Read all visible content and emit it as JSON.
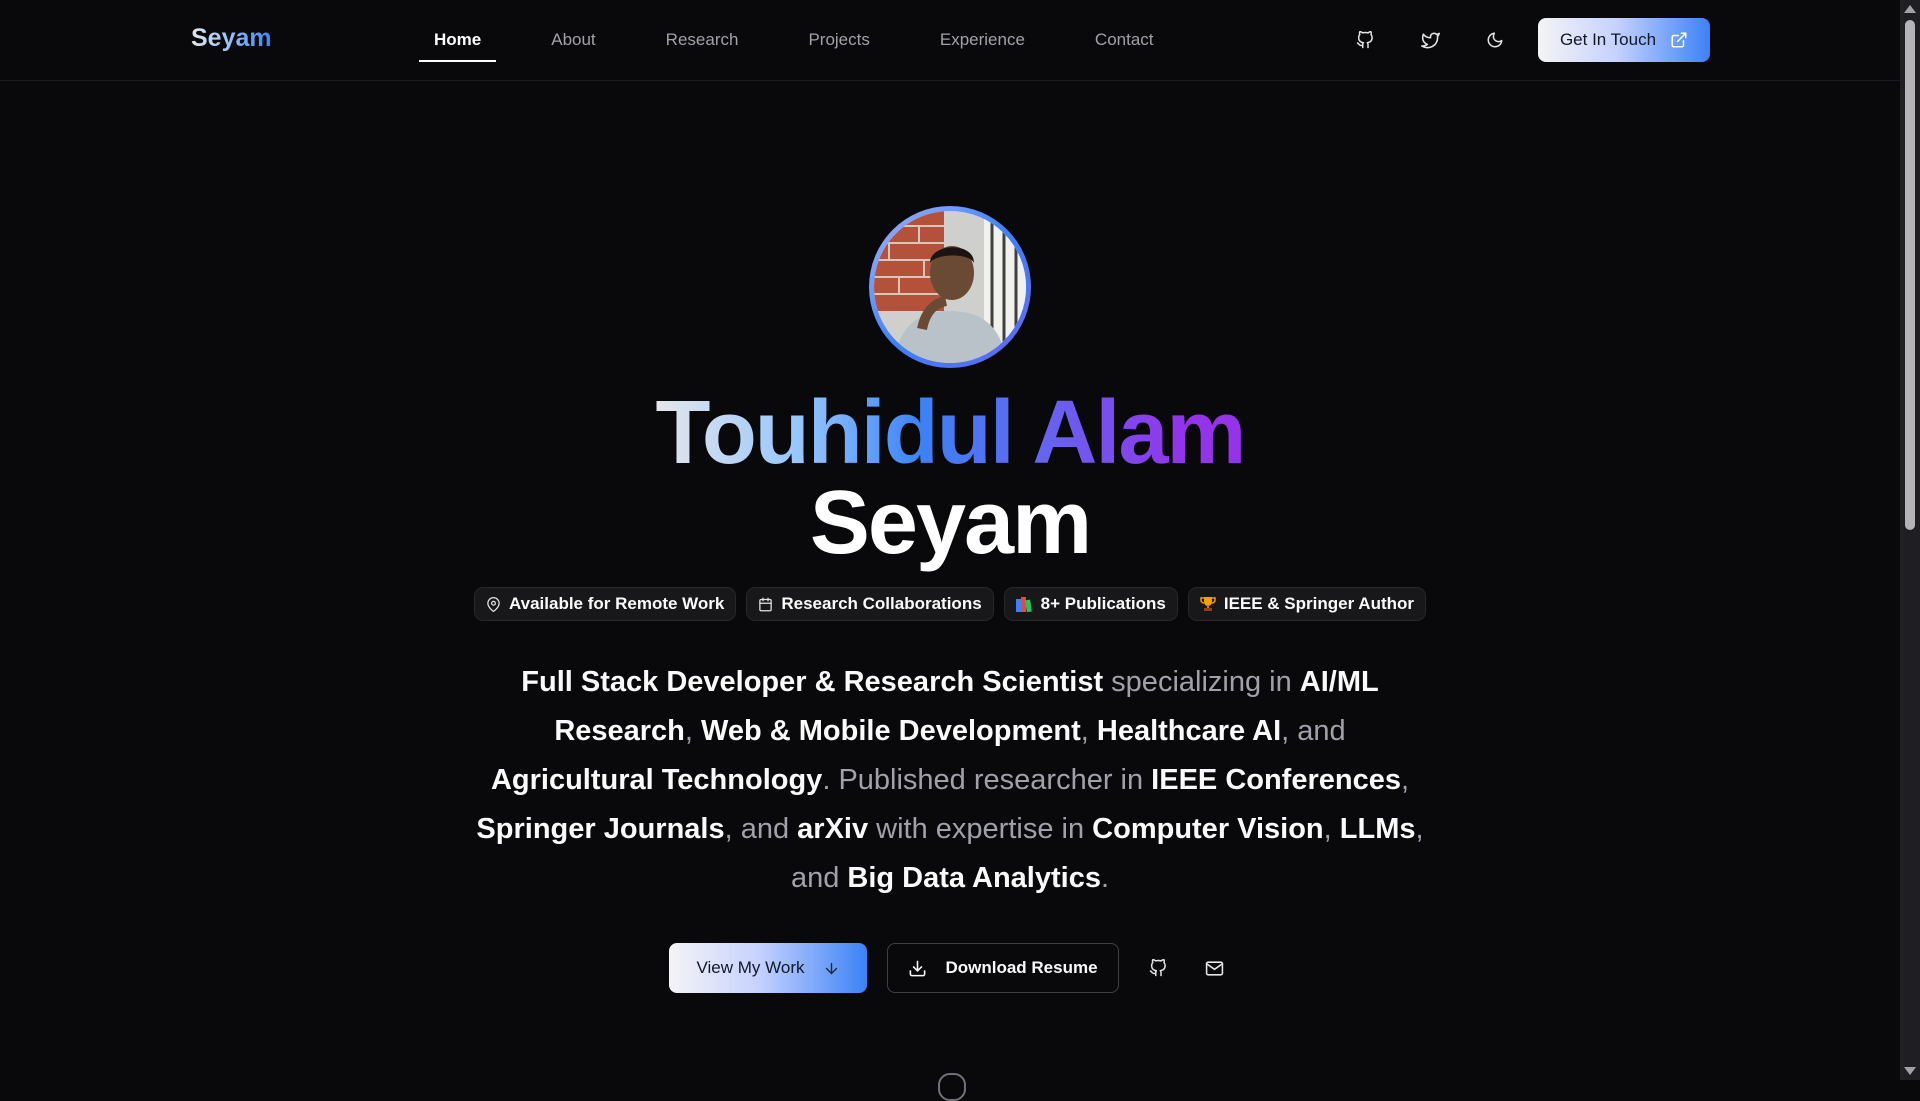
{
  "header": {
    "logo": "Seyam",
    "nav": [
      {
        "label": "Home",
        "active": true
      },
      {
        "label": "About",
        "active": false
      },
      {
        "label": "Research",
        "active": false
      },
      {
        "label": "Projects",
        "active": false
      },
      {
        "label": "Experience",
        "active": false
      },
      {
        "label": "Contact",
        "active": false
      }
    ],
    "icons": [
      "github-icon",
      "twitter-icon",
      "moon-icon"
    ],
    "cta_label": "Get In Touch"
  },
  "hero": {
    "name_part1": "Tou",
    "name_part2": "hidul Alam",
    "name_line2": "Seyam",
    "badges": [
      {
        "icon": "map-pin-icon",
        "label": "Available for Remote Work"
      },
      {
        "icon": "calendar-icon",
        "label": "Research Collaborations"
      },
      {
        "icon": "books-icon",
        "label": "8+ Publications"
      },
      {
        "icon": "trophy-icon",
        "label": "IEEE & Springer Author"
      }
    ],
    "description": [
      {
        "t": "Full Stack Developer & Research Scientist",
        "b": true
      },
      {
        "t": " specializing in ",
        "b": false
      },
      {
        "t": "AI/ML Research",
        "b": true
      },
      {
        "t": ", ",
        "b": false
      },
      {
        "t": "Web & Mobile Development",
        "b": true
      },
      {
        "t": ", ",
        "b": false
      },
      {
        "t": "Healthcare AI",
        "b": true
      },
      {
        "t": ", and ",
        "b": false
      },
      {
        "t": "Agricultural Technology",
        "b": true
      },
      {
        "t": ". Published researcher in ",
        "b": false
      },
      {
        "t": "IEEE Conferences",
        "b": true
      },
      {
        "t": ", ",
        "b": false
      },
      {
        "t": "Springer Journals",
        "b": true
      },
      {
        "t": ", and ",
        "b": false
      },
      {
        "t": "arXiv",
        "b": true
      },
      {
        "t": " with expertise in ",
        "b": false
      },
      {
        "t": "Computer Vision",
        "b": true
      },
      {
        "t": ", ",
        "b": false
      },
      {
        "t": "LLMs",
        "b": true
      },
      {
        "t": ", and ",
        "b": false
      },
      {
        "t": "Big Data Analytics",
        "b": true
      },
      {
        "t": ".",
        "b": false
      }
    ],
    "primary_button": "View My Work",
    "secondary_button": "Download Resume"
  },
  "colors": {
    "background": "#09090b",
    "accent_blue": "#3b82f6",
    "accent_purple": "#9333ea"
  }
}
